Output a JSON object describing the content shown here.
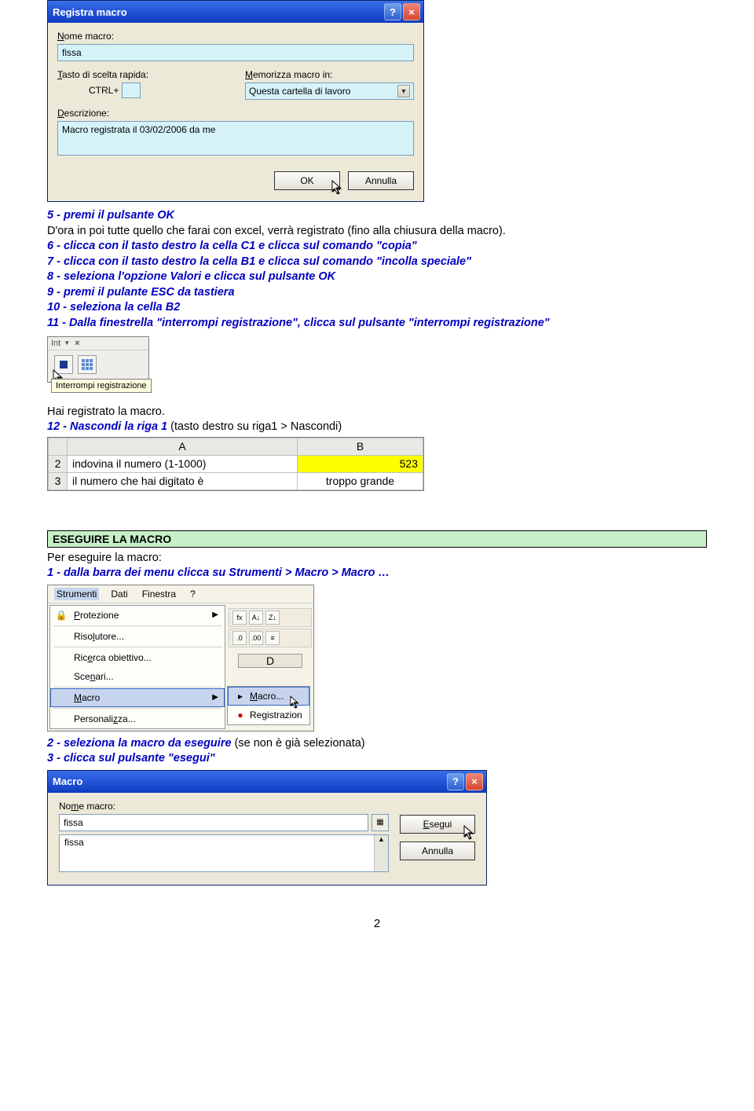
{
  "dialog1": {
    "title": "Registra macro",
    "name_label": "Nome macro:",
    "name_value": "fissa",
    "shortcut_label": "Tasto di scelta rapida:",
    "ctrl_label": "CTRL+",
    "store_label": "Memorizza macro in:",
    "store_value": "Questa cartella di lavoro",
    "desc_label": "Descrizione:",
    "desc_value": "Macro registrata il 03/02/2006 da me",
    "ok": "OK",
    "cancel": "Annulla"
  },
  "instr": {
    "l5": "5 - premi il pulsante OK",
    "l5b": "D'ora in poi tutte quello che farai con excel, verrà registrato (fino alla chiusura della macro).",
    "l6": "6 - clicca con il tasto destro la cella C1 e clicca sul comando \"copia\"",
    "l7": "7 - clicca con il tasto destro la cella B1 e clicca sul comando \"incolla speciale\"",
    "l8": "8 - seleziona l'opzione Valori e clicca sul pulsante OK",
    "l9": "9 - premi il pulante ESC da tastiera",
    "l10": "10 - seleziona la cella B2",
    "l11": "11 - Dalla finestrella \"interrompi registrazione\", clicca sul pulsante \"interrompi registrazione\"",
    "hai": "Hai registrato la macro.",
    "l12": "12 - Nascondi la riga 1 ",
    "l12b": "(tasto destro su riga1 > Nascondi)"
  },
  "stopbox": {
    "head": "Int",
    "tooltip": "Interrompi registrazione"
  },
  "excel": {
    "colA": "A",
    "colB": "B",
    "r2": "2",
    "r3": "3",
    "a2": "indovina il numero (1-1000)",
    "b2": "523",
    "a3": "il numero che hai digitato è",
    "b3": "troppo grande"
  },
  "section2": {
    "heading": "ESEGUIRE LA MACRO",
    "intro": "Per eseguire la macro:",
    "s1": "1 - dalla barra dei menu clicca su Strumenti > Macro > Macro …",
    "s2a": "2 - seleziona la macro da eseguire ",
    "s2b": "(se non è già selezionata)",
    "s3": "3 - clicca sul pulsante \"esegui\""
  },
  "menubar": {
    "m1": "Strumenti",
    "m2": "Dati",
    "m3": "Finestra",
    "m4": "?",
    "i1": "Protezione",
    "i2": "Risolutore...",
    "i3": "Ricerca obiettivo...",
    "i4": "Scenari...",
    "i5": "Macro",
    "i6": "Personalizza...",
    "sub1": "Macro...",
    "sub2": "Registrazion",
    "D": "D"
  },
  "macrodlg": {
    "title": "Macro",
    "name_label": "Nome macro:",
    "name_value": "fissa",
    "list_item": "fissa",
    "run": "Esegui",
    "cancel": "Annulla"
  },
  "pagenum": "2"
}
